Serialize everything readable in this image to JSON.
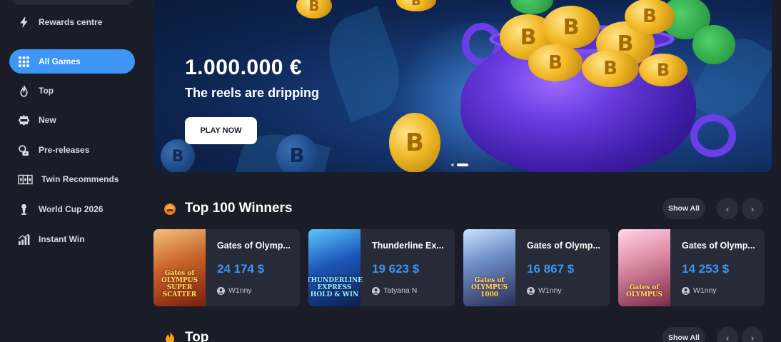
{
  "sidebar": {
    "items": [
      {
        "label": "Rewards centre",
        "icon": "lightning-icon"
      },
      {
        "label": "All Games",
        "icon": "grid-icon",
        "active": true
      },
      {
        "label": "Top",
        "icon": "flame-icon"
      },
      {
        "label": "New",
        "icon": "new-badge-icon"
      },
      {
        "label": "Pre-releases",
        "icon": "pre-release-icon"
      },
      {
        "label": "Twin Recommends",
        "icon": "slot-reels-icon"
      },
      {
        "label": "World Cup 2026",
        "icon": "trophy-icon"
      },
      {
        "label": "Instant Win",
        "icon": "bar-chart-icon"
      }
    ]
  },
  "banner": {
    "title": "1.000.000 €",
    "subtitle": "The reels are dripping",
    "button_label": "PLAY NOW",
    "coin_letter": "B"
  },
  "winners": {
    "title": "Top 100 Winners",
    "show_all": "Show All",
    "prev": "‹",
    "next": "›",
    "cards": [
      {
        "name": "Gates of Olymp...",
        "amount": "24 174 $",
        "user": "W1nny",
        "thumb_label": "Gates of OLYMPUS SUPER SCATTER"
      },
      {
        "name": "Thunderline Ex...",
        "amount": "19 623 $",
        "user": "Tatyana N",
        "thumb_label": "THUNDERLINE EXPRESS HOLD & WIN"
      },
      {
        "name": "Gates of Olymp...",
        "amount": "16 867 $",
        "user": "W1nny",
        "thumb_label": "Gates of OLYMPUS 1000"
      },
      {
        "name": "Gates of Olymp...",
        "amount": "14 253 $",
        "user": "W1nny",
        "thumb_label": "Gates of OLYMPUS"
      }
    ]
  },
  "top": {
    "title": "Top",
    "show_all": "Show All",
    "prev": "‹",
    "next": "›"
  },
  "colors": {
    "accent": "#3d95f5",
    "background": "#1a1d27",
    "card": "#272b37"
  }
}
